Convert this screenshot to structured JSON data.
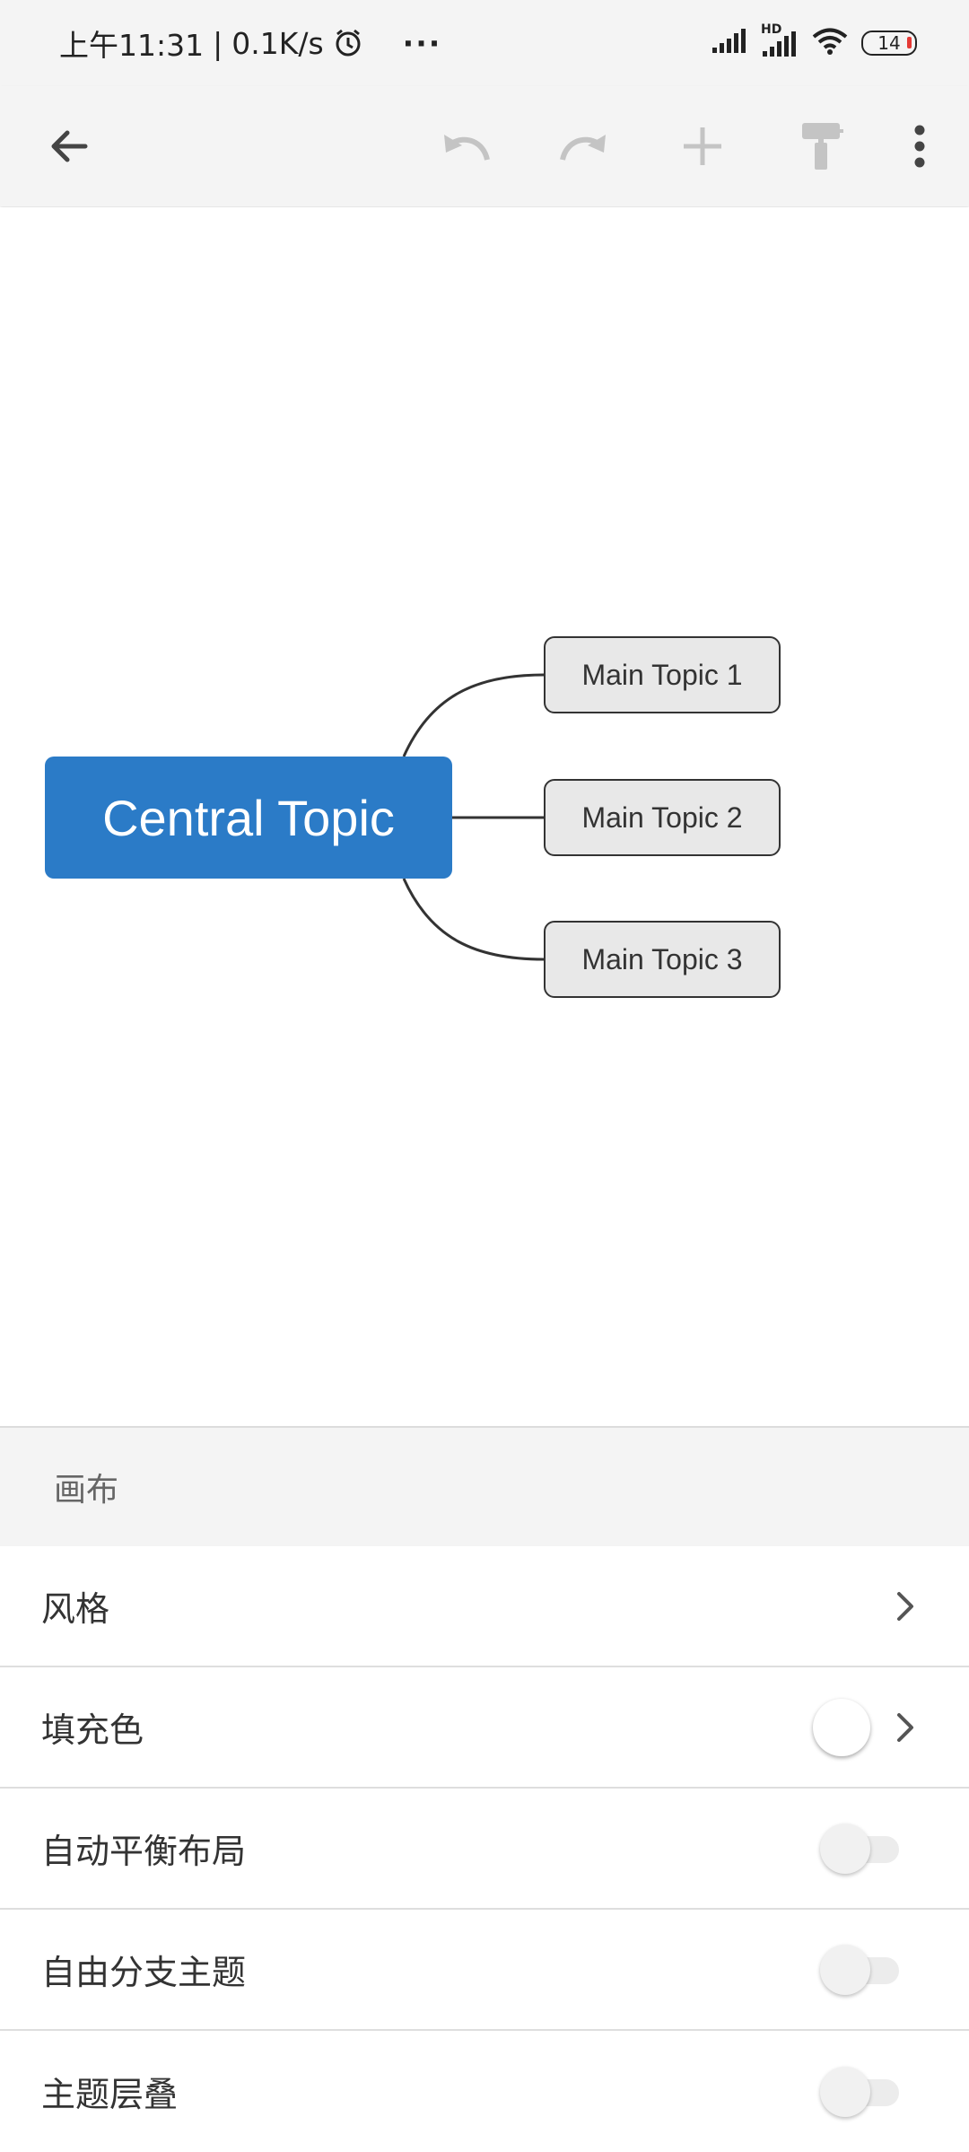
{
  "status_bar": {
    "time": "上午11:31",
    "separator": "|",
    "network_speed": "0.1K/s",
    "more": "···",
    "hd_label": "HD",
    "battery": "14"
  },
  "toolbar": {
    "icons": [
      "back-arrow-icon",
      "undo-icon",
      "redo-icon",
      "add-icon",
      "format-painter-icon",
      "more-vert-icon"
    ]
  },
  "canvas": {
    "central_topic": "Central Topic",
    "main_topics": [
      "Main Topic 1",
      "Main Topic 2",
      "Main Topic 3"
    ],
    "central_color": "#2b7bc7"
  },
  "panel": {
    "header": "画布",
    "rows": [
      {
        "label": "风格",
        "control": "chevron"
      },
      {
        "label": "填充色",
        "control": "color-swatch"
      },
      {
        "label": "自动平衡布局",
        "control": "toggle",
        "value": false
      },
      {
        "label": "自由分支主题",
        "control": "toggle",
        "value": false
      },
      {
        "label": "主题层叠",
        "control": "toggle",
        "value": false
      }
    ]
  }
}
